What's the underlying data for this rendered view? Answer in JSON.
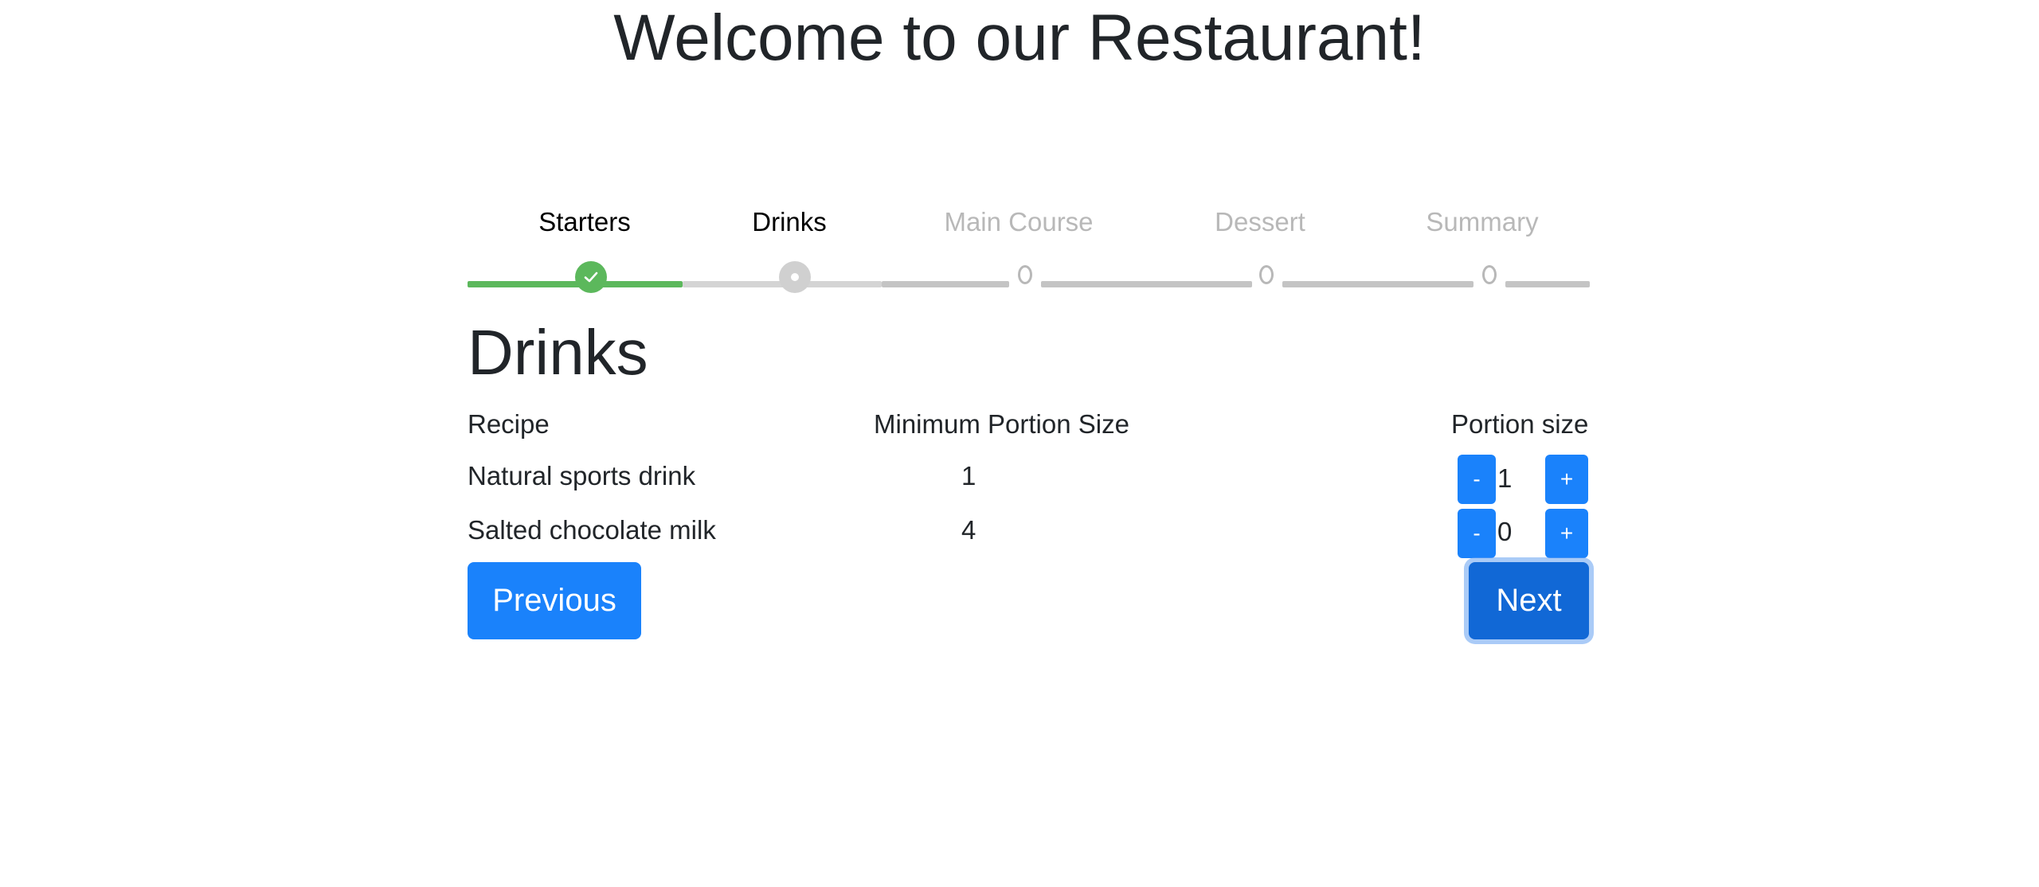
{
  "page": {
    "title": "Welcome to our Restaurant!"
  },
  "wizard": {
    "steps": [
      {
        "label": "Starters",
        "state": "completed"
      },
      {
        "label": "Drinks",
        "state": "current"
      },
      {
        "label": "Main Course",
        "state": "pending"
      },
      {
        "label": "Dessert",
        "state": "pending"
      },
      {
        "label": "Summary",
        "state": "pending"
      }
    ],
    "colors": {
      "completed": "#5cb85c",
      "current": "#d0d0d0",
      "pending": "#b8b8b8"
    }
  },
  "section": {
    "title": "Drinks",
    "columns": [
      "Recipe",
      "Minimum Portion Size",
      "Portion size"
    ],
    "rows": [
      {
        "recipe": "Natural sports drink",
        "min_portion": "1",
        "portion": "1"
      },
      {
        "recipe": "Salted chocolate milk",
        "min_portion": "4",
        "portion": "0"
      }
    ],
    "decrement_label": "-",
    "increment_label": "+"
  },
  "nav": {
    "previous_label": "Previous",
    "next_label": "Next"
  },
  "colors": {
    "primary": "#1a82fb",
    "primary_active": "#1168d6"
  }
}
